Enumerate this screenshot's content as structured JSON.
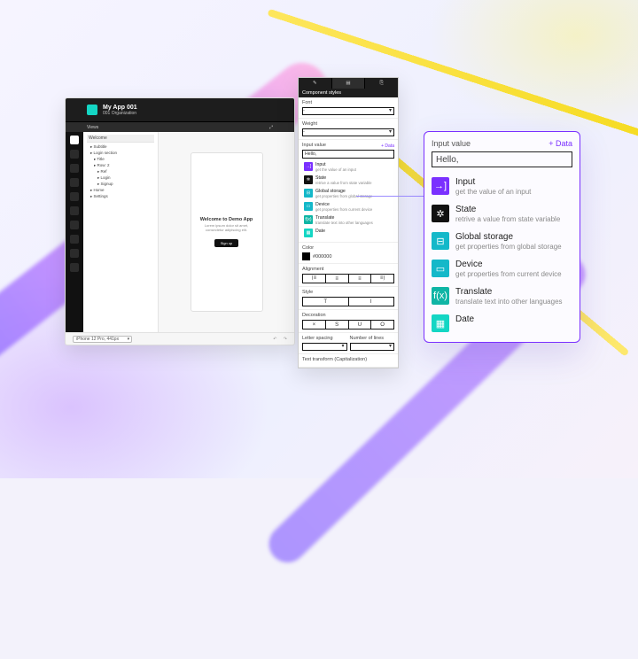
{
  "app": {
    "title": "My App 001",
    "org": "001 Organization",
    "views_label": "Views",
    "tree_tab": "Welcome",
    "tree": [
      {
        "label": "Subtitle",
        "indent": 0
      },
      {
        "label": "Login section",
        "indent": 0
      },
      {
        "label": "Title",
        "indent": 1
      },
      {
        "label": "Row: 2",
        "indent": 1
      },
      {
        "label": "Ref",
        "indent": 2
      },
      {
        "label": "Login",
        "indent": 2
      },
      {
        "label": "Signup",
        "indent": 2
      },
      {
        "label": "Home",
        "indent": 0
      },
      {
        "label": "Settings",
        "indent": 0
      }
    ],
    "canvas": {
      "heading": "Welcome to Demo App",
      "body": "Lorem ipsum dolor sit amet, consectetur adipiscing elit.",
      "cta": "Sign up"
    },
    "footer": {
      "device": "iPhone 12 Pro, 441px",
      "undo": "↶",
      "redo": "↷"
    },
    "nav": [
      "home-icon",
      "add-icon",
      "design-icon",
      "logic-icon",
      "data-icon",
      "theme-icon",
      "users-icon",
      "team-icon",
      "publish-icon",
      "settings-icon"
    ]
  },
  "panel": {
    "title": "Component styles",
    "tabs": [
      "pencil-icon",
      "styles-icon",
      "link-icon"
    ],
    "sections": {
      "font": {
        "label": "Font",
        "value": "-"
      },
      "weight": {
        "label": "Weight",
        "value": "-"
      },
      "input": {
        "label": "Input value",
        "action": "+ Data",
        "value": "Hello,"
      },
      "color": {
        "label": "Color",
        "value": "#000000"
      },
      "alignment": {
        "label": "Alignment",
        "icons": [
          "⟮≡",
          "≡",
          "≡",
          "≡⟯"
        ]
      },
      "style": {
        "label": "Style",
        "icons": [
          "T",
          "I"
        ]
      },
      "decoration": {
        "label": "Decoration",
        "icons": [
          "×",
          "S",
          "U",
          "O"
        ]
      },
      "letter_spacing": "Letter spacing",
      "number_of_lines": "Number of lines",
      "text_transform": "Text transform (Capitalization)"
    },
    "dropdown": [
      {
        "title": "Input",
        "desc": "get the value of an input",
        "cls": "c1",
        "glyph": "→]"
      },
      {
        "title": "State",
        "desc": "retrive a value from state variable",
        "cls": "c2",
        "glyph": "✲"
      },
      {
        "title": "Global storage",
        "desc": "get properties from global storage",
        "cls": "c3",
        "glyph": "⊟"
      },
      {
        "title": "Device",
        "desc": "get properties from current device",
        "cls": "c4",
        "glyph": "▭"
      },
      {
        "title": "Translate",
        "desc": "translate text into other languages",
        "cls": "c5",
        "glyph": "f(x)"
      },
      {
        "title": "Date",
        "desc": "",
        "cls": "c6",
        "glyph": "▦"
      }
    ]
  },
  "zoom": {
    "label": "Input value",
    "action": "+ Data",
    "input_value": "Hello,",
    "items": [
      {
        "title": "Input",
        "desc": "get the value of an input",
        "cls": "zc1",
        "glyph": "→]"
      },
      {
        "title": "State",
        "desc": "retrive a value from state variable",
        "cls": "zc2",
        "glyph": "✲"
      },
      {
        "title": "Global storage",
        "desc": "get properties from global storage",
        "cls": "zc3",
        "glyph": "⊟"
      },
      {
        "title": "Device",
        "desc": "get properties from current device",
        "cls": "zc4",
        "glyph": "▭"
      },
      {
        "title": "Translate",
        "desc": "translate text into other languages",
        "cls": "zc5",
        "glyph": "f(x)"
      },
      {
        "title": "Date",
        "desc": "",
        "cls": "zc6",
        "glyph": "▦"
      }
    ]
  }
}
